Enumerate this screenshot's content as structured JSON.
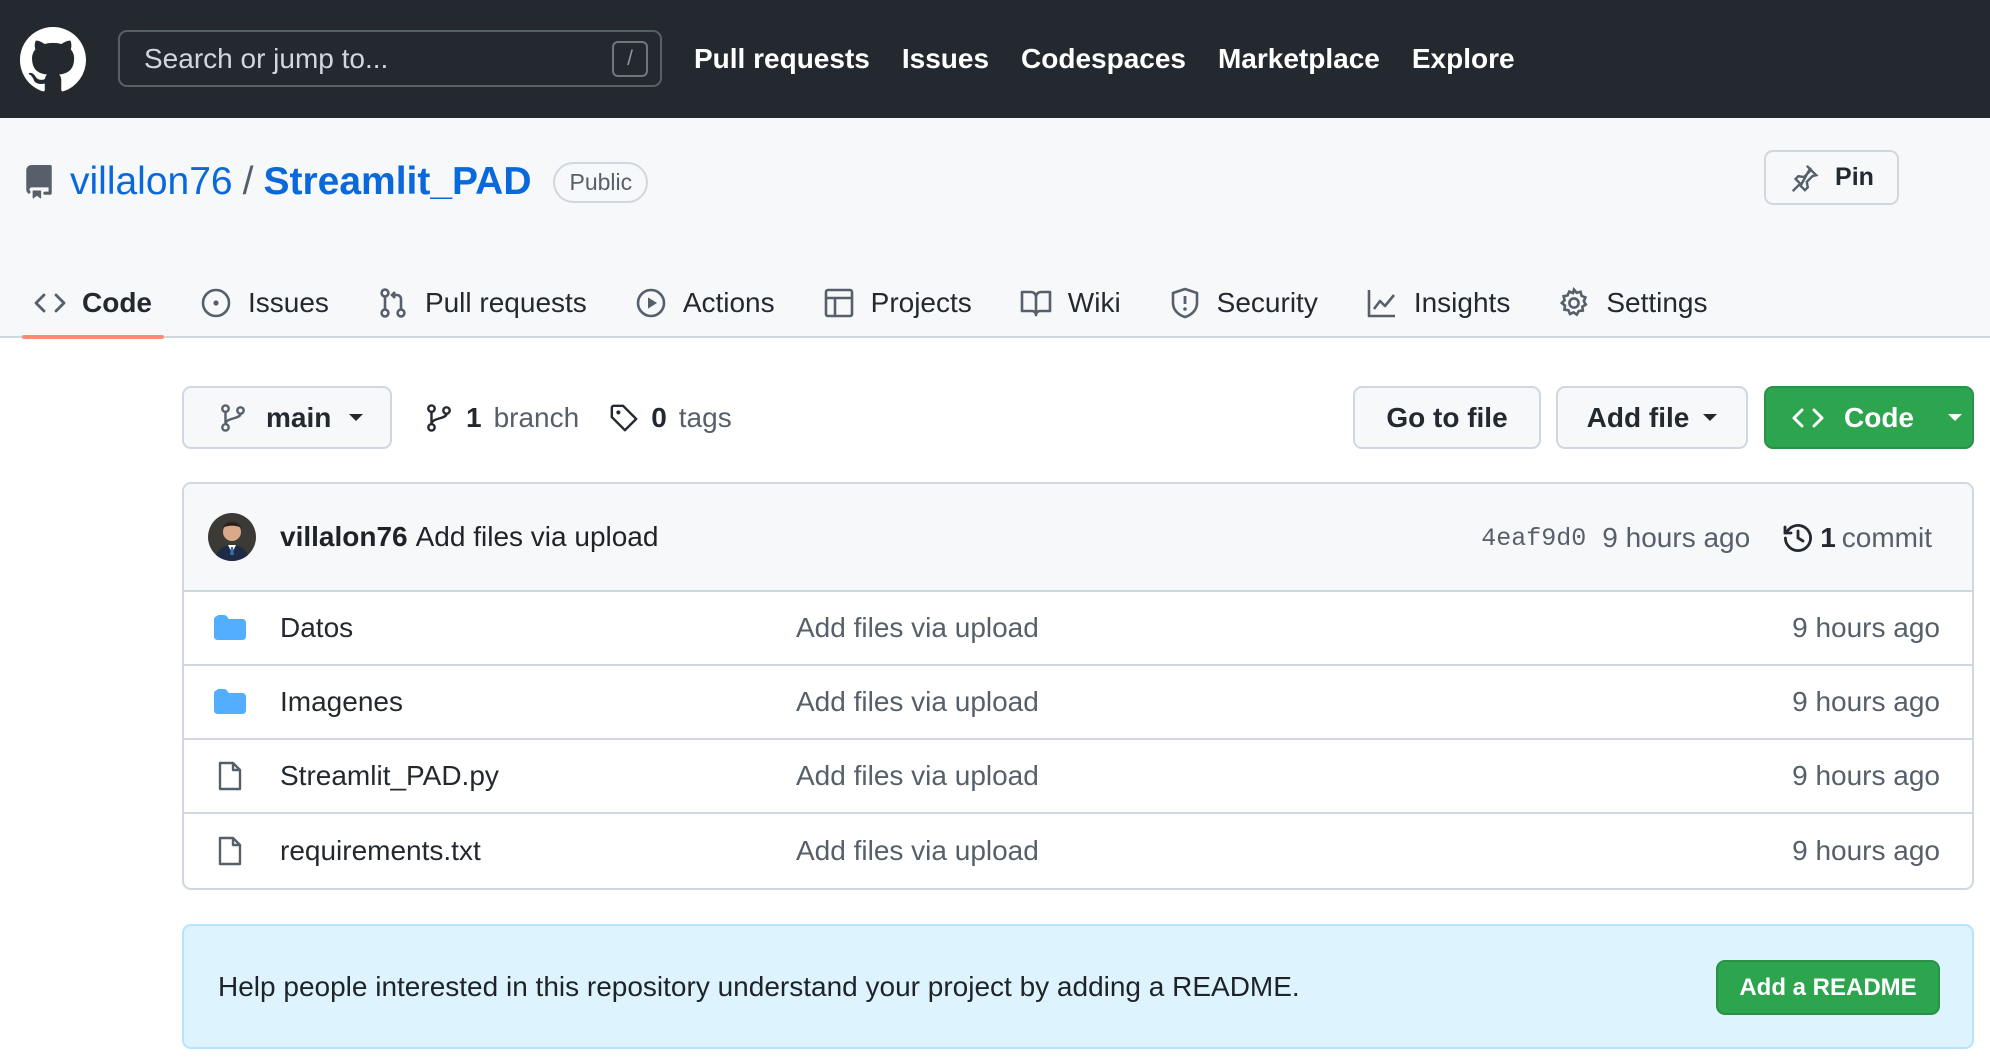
{
  "header": {
    "search_placeholder": "Search or jump to...",
    "search_shortcut": "/",
    "nav": [
      "Pull requests",
      "Issues",
      "Codespaces",
      "Marketplace",
      "Explore"
    ]
  },
  "repo": {
    "owner": "villalon76",
    "separator": "/",
    "name": "Streamlit_PAD",
    "visibility": "Public",
    "pin_label": "Pin"
  },
  "tabs": [
    {
      "label": "Code",
      "icon": "code-icon",
      "active": true
    },
    {
      "label": "Issues",
      "icon": "issue-icon"
    },
    {
      "label": "Pull requests",
      "icon": "pull-request-icon"
    },
    {
      "label": "Actions",
      "icon": "play-icon"
    },
    {
      "label": "Projects",
      "icon": "table-icon"
    },
    {
      "label": "Wiki",
      "icon": "book-icon"
    },
    {
      "label": "Security",
      "icon": "shield-icon"
    },
    {
      "label": "Insights",
      "icon": "graph-icon"
    },
    {
      "label": "Settings",
      "icon": "gear-icon"
    }
  ],
  "controls": {
    "branch": "main",
    "branch_count": "1",
    "branch_label": "branch",
    "tag_count": "0",
    "tag_label": "tags",
    "goto_file": "Go to file",
    "add_file": "Add file",
    "code": "Code"
  },
  "latest_commit": {
    "author": "villalon76",
    "message": "Add files via upload",
    "sha": "4eaf9d0",
    "time": "9 hours ago",
    "commit_count": "1",
    "commit_label": "commit"
  },
  "files": [
    {
      "name": "Datos",
      "type": "folder",
      "message": "Add files via upload",
      "time": "9 hours ago"
    },
    {
      "name": "Imagenes",
      "type": "folder",
      "message": "Add files via upload",
      "time": "9 hours ago"
    },
    {
      "name": "Streamlit_PAD.py",
      "type": "file",
      "message": "Add files via upload",
      "time": "9 hours ago"
    },
    {
      "name": "requirements.txt",
      "type": "file",
      "message": "Add files via upload",
      "time": "9 hours ago"
    }
  ],
  "readme_banner": {
    "text": "Help people interested in this repository understand your project by adding a README.",
    "button": "Add a README"
  },
  "colors": {
    "header_bg": "#24292f",
    "link": "#0969da",
    "green": "#2da44e",
    "tab_underline": "#fd8c73",
    "folder": "#54aeff",
    "readme_bg": "#ddf4ff"
  }
}
